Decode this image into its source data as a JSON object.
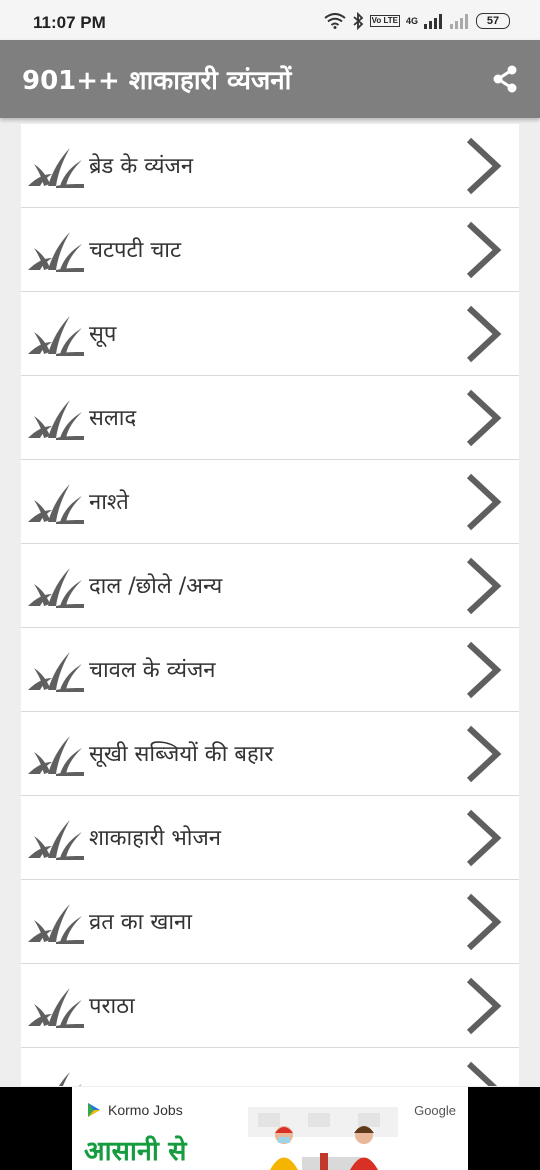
{
  "status_bar": {
    "time": "11:07 PM",
    "network_tag": "Vo LTE",
    "network_type": "4G",
    "battery": "57"
  },
  "app_bar": {
    "title": "901++ शाकाहारी व्यंजनों",
    "share_icon": "share-icon"
  },
  "list": {
    "item_icon": "leaf-icon",
    "trailing_icon": "chevron-right-icon",
    "items": [
      {
        "label": "ब्रेड के व्यंजन"
      },
      {
        "label": "चटपटी चाट"
      },
      {
        "label": "सूप"
      },
      {
        "label": "सलाद"
      },
      {
        "label": "नाश्ते"
      },
      {
        "label": "दाल /छोले /अन्य"
      },
      {
        "label": "चावल के व्यंजन"
      },
      {
        "label": "सूखी सब्जियों की बहार"
      },
      {
        "label": "शाकाहारी भोजन"
      },
      {
        "label": "व्रत का खाना"
      },
      {
        "label": "पराठा"
      },
      {
        "label": ""
      }
    ]
  },
  "ad": {
    "brand": "Kormo Jobs",
    "network": "Google",
    "headline": "आसानी से"
  },
  "colors": {
    "app_bar": "#7f7f7f",
    "icon_gray": "#5f5f5f",
    "ad_green": "#159c3f"
  }
}
